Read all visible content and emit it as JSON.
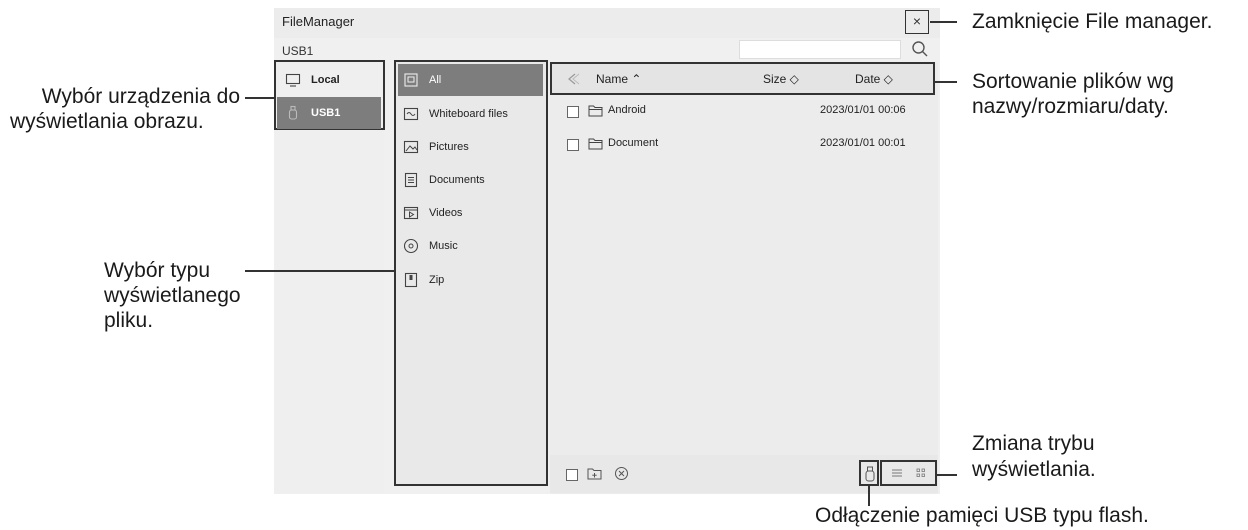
{
  "window": {
    "title": "FileManager",
    "close_label": "×"
  },
  "location": {
    "path": "USB1"
  },
  "search": {
    "placeholder": ""
  },
  "devices": [
    {
      "label": "Local",
      "icon": "monitor-icon",
      "active": false
    },
    {
      "label": "USB1",
      "icon": "usb-drive-icon",
      "active": true
    }
  ],
  "categories": [
    {
      "label": "All",
      "icon": "all-files-icon",
      "active": true
    },
    {
      "label": "Whiteboard files",
      "icon": "whiteboard-icon",
      "active": false
    },
    {
      "label": "Pictures",
      "icon": "picture-icon",
      "active": false
    },
    {
      "label": "Documents",
      "icon": "document-icon",
      "active": false
    },
    {
      "label": "Videos",
      "icon": "video-icon",
      "active": false
    },
    {
      "label": "Music",
      "icon": "music-icon",
      "active": false
    },
    {
      "label": "Zip",
      "icon": "zip-icon",
      "active": false
    }
  ],
  "list_header": {
    "name": "Name ⌃",
    "size": "Size ◇",
    "date": "Date ◇"
  },
  "files": [
    {
      "name": "Android",
      "date": "2023/01/01 00:06",
      "icon": "folder-icon"
    },
    {
      "name": "Document",
      "date": "2023/01/01 00:01",
      "icon": "folder-icon"
    }
  ],
  "callouts": {
    "close": "Zamknięcie File manager.",
    "device_line1": "Wybór urządzenia do",
    "device_line2": "wyświetlania obrazu.",
    "sort_line1": "Sortowanie plików wg",
    "sort_line2": "nazwy/rozmiaru/daty.",
    "type_line1": "Wybór typu",
    "type_line2": "wyświetlanego",
    "type_line3": "pliku.",
    "view_line1": "Zmiana trybu",
    "view_line2": "wyświetlania.",
    "usb": "Odłączenie pamięci USB typu flash."
  },
  "colors": {
    "active_bg": "#7d7d7d",
    "panel_bg": "#ececec",
    "outline": "#333333"
  }
}
